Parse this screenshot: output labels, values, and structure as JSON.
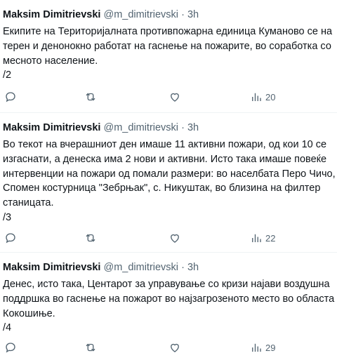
{
  "tweets": [
    {
      "name": "Maksim Dimitrievski",
      "handle": "@m_dimitrievski",
      "dot": "·",
      "time": "3h",
      "lines": [
        "Екипите на Територијалната противпожарна единица Куманово се на",
        "терен и денонокно работат на гаснење на пожарите, во соработка со",
        "месното население.",
        "/2"
      ],
      "views": "20"
    },
    {
      "name": "Maksim Dimitrievski",
      "handle": "@m_dimitrievski",
      "dot": "·",
      "time": "3h",
      "lines": [
        "Во текот на вчерашниот ден имаше 11 активни пожари, од кои 10 се",
        "изгаснати, а денеска има 2 нови и активни. Исто така имаше повеќе",
        "интервенции на пожари од помали размери: во населбата Перо Чичо,",
        "Спомен костурница \"Зебрњак\", с. Никуштак, во близина на филтер",
        "станицата.",
        "/3"
      ],
      "views": "22"
    },
    {
      "name": "Maksim Dimitrievski",
      "handle": "@m_dimitrievski",
      "dot": "·",
      "time": "3h",
      "lines": [
        "Денес, исто така, Центарот за управување со кризи најави воздушна",
        "поддршка во гаснење на пожарот во најзагрозеното место во областа",
        "Кокошиње.",
        "/4"
      ],
      "views": "29"
    }
  ]
}
